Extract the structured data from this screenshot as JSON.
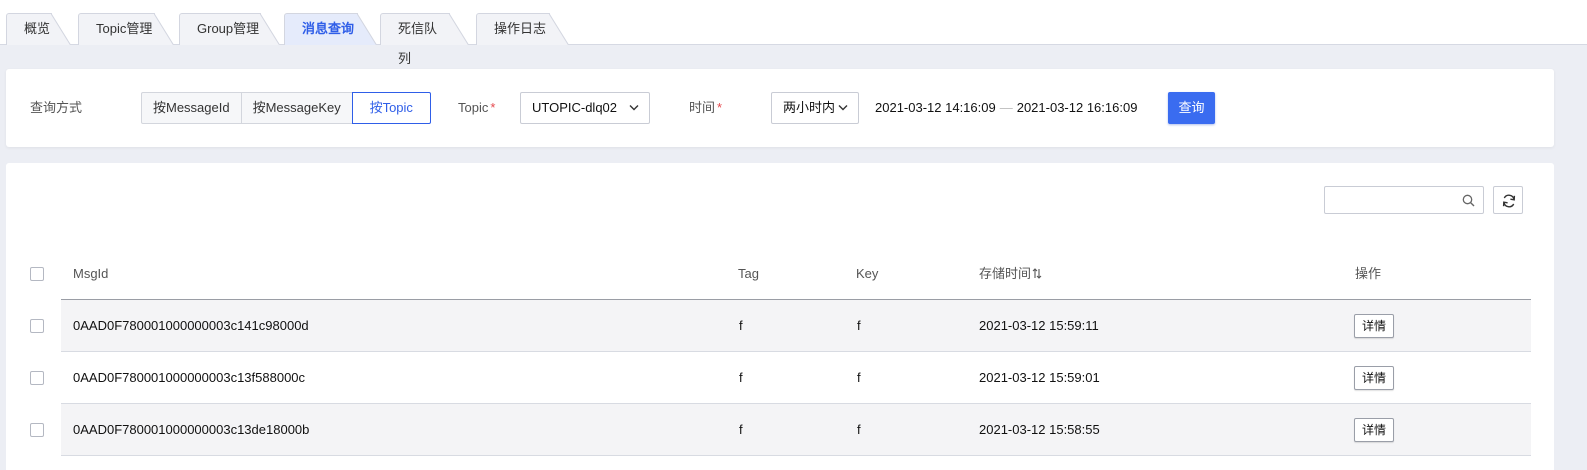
{
  "tabs": [
    {
      "label": "概览"
    },
    {
      "label": "Topic管理"
    },
    {
      "label": "Group管理"
    },
    {
      "label": "消息查询",
      "active": true
    },
    {
      "label": "死信队列"
    },
    {
      "label": "操作日志"
    }
  ],
  "filter": {
    "query_mode_label": "查询方式",
    "modes": [
      "按MessageId",
      "按MessageKey",
      "按Topic"
    ],
    "active_mode": "按Topic",
    "topic_label": "Topic",
    "topic_value": "UTOPIC-dlq02",
    "time_label": "时间",
    "time_range_value": "两小时内",
    "date_start": "2021-03-12 14:16:09",
    "date_sep": "—",
    "date_end": "2021-03-12 16:16:09",
    "query_button": "查询"
  },
  "table": {
    "search_placeholder": "",
    "columns": {
      "msgid": "MsgId",
      "tag": "Tag",
      "key": "Key",
      "time": "存储时间",
      "action": "操作"
    },
    "rows": [
      {
        "msgid": "0AAD0F780001000000003c141c98000d",
        "tag": "f",
        "key": "f",
        "time": "2021-03-12 15:59:11",
        "action": "详情"
      },
      {
        "msgid": "0AAD0F780001000000003c13f588000c",
        "tag": "f",
        "key": "f",
        "time": "2021-03-12 15:59:01",
        "action": "详情"
      },
      {
        "msgid": "0AAD0F780001000000003c13de18000b",
        "tag": "f",
        "key": "f",
        "time": "2021-03-12 15:58:55",
        "action": "详情"
      }
    ]
  },
  "colors": {
    "primary": "#3a6cf0",
    "active_tab_text": "#2f5ee8",
    "required_mark": "#e5484d"
  }
}
